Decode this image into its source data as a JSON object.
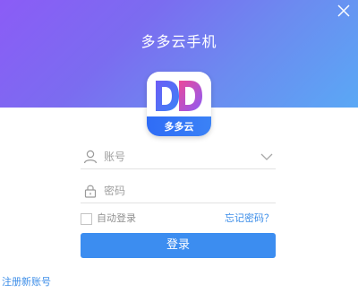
{
  "window": {
    "title": "多多云手机"
  },
  "logo": {
    "mark": "DD",
    "band_text": "多多云"
  },
  "account_field": {
    "placeholder": "账号",
    "value": ""
  },
  "password_field": {
    "placeholder": "密码",
    "value": ""
  },
  "options": {
    "auto_login_label": "自动登录",
    "auto_login_checked": false,
    "forgot_password_label": "忘记密码？"
  },
  "login_button": {
    "label": "登录"
  },
  "register_link": {
    "label": "注册新账号"
  },
  "icons": [
    "close-icon",
    "user-icon",
    "lock-icon",
    "chevron-down-icon"
  ],
  "colors": {
    "accent": "#3c8df0",
    "link": "#3d8ee8",
    "header_start": "#8b5cf6",
    "header_end": "#5aa8f5"
  }
}
